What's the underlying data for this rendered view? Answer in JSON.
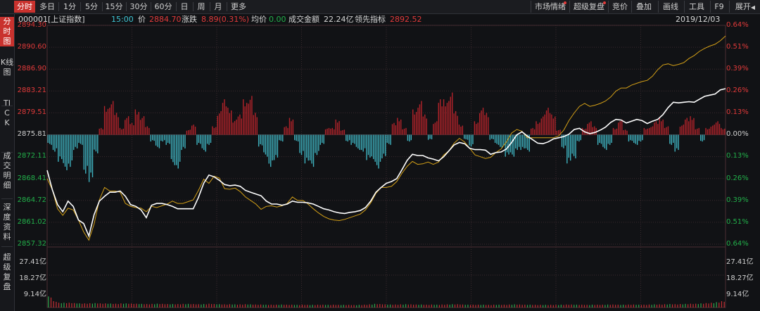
{
  "toolbar": {
    "tabs": [
      "分时",
      "多日",
      "1分",
      "5分",
      "15分",
      "30分",
      "60分",
      "日",
      "周",
      "月",
      "更多"
    ],
    "right_tabs": [
      "市场情绪",
      "超级复盘",
      "竞价",
      "叠加",
      "画线",
      "工具",
      "F9",
      "展开"
    ]
  },
  "sidebar": {
    "items": [
      "分时图",
      "K线图",
      "TICK",
      "成交明细",
      "深度资料",
      "超级复盘"
    ]
  },
  "info": {
    "code": "000001[上证指数]",
    "time": "15:00",
    "price_label": "价",
    "price": "2884.70",
    "change_label": "涨跌",
    "change": "8.89(0.31%)",
    "avg_label": "均价",
    "avg": "0.00",
    "amount_label": "成交金额",
    "amount": "22.24亿",
    "lead_label": "领先指标",
    "lead": "2892.52",
    "date": "2019/12/03"
  },
  "colors": {
    "up": "#e23a3a",
    "down": "#22b04a",
    "price_line": "#ffffff",
    "lead_line": "#d4a017",
    "bar_up": "#b3232a",
    "bar_down": "#3fb3c0",
    "grid": "#3a2a2e"
  },
  "chart_data": {
    "type": "line",
    "title": "",
    "xlabel": "",
    "ylabel": "",
    "ylim": [
      2857.32,
      2894.3
    ],
    "prev_close": 2875.81,
    "price_axis": [
      "2894.30",
      "2890.60",
      "2886.90",
      "2883.21",
      "2879.51",
      "2875.81",
      "2872.11",
      "2868.41",
      "2864.72",
      "2861.02",
      "2857.32"
    ],
    "pct_axis": [
      "0.64%",
      "0.51%",
      "0.39%",
      "0.26%",
      "0.13%",
      "0.00%",
      "0.13%",
      "0.26%",
      "0.39%",
      "0.51%",
      "0.64%"
    ],
    "volume_axis": [
      "27.41亿",
      "18.27亿",
      "9.14亿"
    ],
    "volume_ylim": [
      0,
      36.55
    ],
    "series": [
      {
        "key": "price",
        "values": [
          2869.8,
          2866.5,
          2864.0,
          2862.8,
          2864.6,
          2863.7,
          2861.4,
          2860.8,
          2858.7,
          2862.3,
          2864.6,
          2865.4,
          2866.1,
          2866.1,
          2866.3,
          2865.4,
          2864.0,
          2863.7,
          2863.1,
          2861.8,
          2863.9,
          2864.2,
          2864.2,
          2864.0,
          2863.7,
          2863.3,
          2863.3,
          2863.3,
          2863.3,
          2865.2,
          2867.6,
          2869.0,
          2868.7,
          2868.1,
          2867.4,
          2867.2,
          2867.3,
          2867.1,
          2866.4,
          2866.1,
          2865.8,
          2865.5,
          2864.6,
          2864.1,
          2864.1,
          2863.9,
          2864.1,
          2864.6,
          2864.4,
          2864.4,
          2864.3,
          2864.1,
          2863.7,
          2863.3,
          2863.1,
          2862.8,
          2862.6,
          2862.5,
          2862.7,
          2862.8,
          2863.0,
          2863.5,
          2864.6,
          2866.1,
          2866.9,
          2867.6,
          2867.9,
          2868.4,
          2869.9,
          2871.5,
          2872.5,
          2872.3,
          2872.3,
          2871.9,
          2871.7,
          2871.4,
          2872.1,
          2873.1,
          2874.1,
          2874.5,
          2874.3,
          2873.5,
          2873.3,
          2873.3,
          2873.2,
          2872.5,
          2872.8,
          2872.9,
          2873.4,
          2874.5,
          2875.8,
          2876.3,
          2875.6,
          2875.0,
          2874.4,
          2874.3,
          2874.6,
          2875.1,
          2875.3,
          2875.5,
          2875.9,
          2876.7,
          2876.9,
          2876.3,
          2876.0,
          2876.2,
          2876.6,
          2877.1,
          2877.9,
          2878.4,
          2878.3,
          2877.8,
          2878.1,
          2878.4,
          2878.2,
          2877.7,
          2878.1,
          2878.4,
          2879.2,
          2880.4,
          2881.3,
          2881.2,
          2881.3,
          2881.4,
          2881.3,
          2881.8,
          2882.3,
          2882.5,
          2882.7,
          2883.4,
          2883.6
        ]
      },
      {
        "key": "lead",
        "values": [
          2868.4,
          2866.5,
          2863.3,
          2862.2,
          2863.4,
          2863.1,
          2861.4,
          2859.4,
          2858.0,
          2860.7,
          2864.8,
          2866.9,
          2866.3,
          2866.3,
          2866.1,
          2864.2,
          2863.7,
          2863.5,
          2863.4,
          2862.8,
          2863.7,
          2863.5,
          2863.8,
          2864.1,
          2864.6,
          2864.2,
          2864.2,
          2864.5,
          2864.8,
          2866.4,
          2868.3,
          2867.6,
          2868.8,
          2868.5,
          2866.7,
          2866.6,
          2866.8,
          2866.2,
          2865.3,
          2864.7,
          2864.1,
          2863.2,
          2863.7,
          2863.8,
          2863.6,
          2863.8,
          2864.2,
          2865.3,
          2864.7,
          2864.7,
          2864.1,
          2863.3,
          2862.6,
          2862.0,
          2861.6,
          2861.4,
          2861.3,
          2861.5,
          2861.8,
          2862.1,
          2862.4,
          2863.1,
          2864.3,
          2865.9,
          2866.9,
          2866.9,
          2867.1,
          2867.9,
          2869.3,
          2870.5,
          2871.3,
          2870.8,
          2870.9,
          2871.2,
          2870.8,
          2871.2,
          2872.4,
          2873.1,
          2874.4,
          2875.2,
          2874.6,
          2873.5,
          2872.4,
          2872.1,
          2871.8,
          2872.0,
          2872.8,
          2873.4,
          2874.6,
          2876.1,
          2876.7,
          2876.4,
          2875.3,
          2875.3,
          2875.3,
          2875.3,
          2875.3,
          2875.3,
          2875.6,
          2876.6,
          2878.2,
          2879.5,
          2880.6,
          2881.1,
          2880.6,
          2880.8,
          2881.1,
          2881.5,
          2882.2,
          2883.2,
          2883.7,
          2883.7,
          2884.2,
          2884.5,
          2884.8,
          2885.0,
          2885.7,
          2886.8,
          2887.6,
          2887.8,
          2887.5,
          2887.7,
          2888.0,
          2888.7,
          2889.2,
          2889.9,
          2890.4,
          2890.8,
          2891.1,
          2891.7,
          2892.5
        ]
      }
    ],
    "lead_bars": [
      -0.6,
      -1.0,
      -1.6,
      -2.1,
      -1.9,
      -0.9,
      -0.6,
      -2.3,
      -2.8,
      -1.1,
      0.4,
      1.7,
      2.0,
      1.3,
      0.4,
      1.1,
      0.7,
      1.5,
      1.1,
      0.5,
      -0.4,
      -0.8,
      -0.4,
      -0.6,
      -1.8,
      -2.0,
      -0.9,
      0.3,
      0.6,
      -0.6,
      -1.0,
      -0.6,
      0.5,
      1.4,
      2.1,
      1.6,
      0.9,
      1.2,
      2.1,
      2.3,
      1.3,
      -0.7,
      -1.3,
      -1.9,
      -1.5,
      -0.4,
      0.5,
      1.0,
      -0.4,
      -1.2,
      -1.7,
      -1.9,
      -1.2,
      -0.6,
      0.4,
      0.4,
      0.9,
      0.3,
      -0.4,
      -0.6,
      -0.9,
      -1.0,
      -1.5,
      -1.6,
      -2.0,
      -1.4,
      -0.6,
      0.7,
      1.0,
      0.4,
      -0.4,
      1.5,
      2.0,
      1.2,
      -0.3,
      0.8,
      2.1,
      2.1,
      2.5,
      1.4,
      0.6,
      -0.3,
      -0.7,
      0.8,
      1.6,
      1.3,
      -0.3,
      -0.6,
      -0.8,
      -1.3,
      -1.3,
      -0.9,
      -0.9,
      -1.0,
      0.4,
      0.8,
      1.2,
      1.6,
      1.2,
      0.3,
      -0.8,
      -1.7,
      -1.4,
      -0.4,
      0.4,
      0.8,
      0.5,
      -0.6,
      -0.9,
      -0.6,
      0.4,
      0.9,
      0.3,
      -0.4,
      -0.6,
      -0.4,
      0.4,
      0.5,
      0.8,
      1.0,
      0.5,
      -0.6,
      -1.0,
      0.6,
      1.0,
      1.1,
      0.4,
      -0.4,
      0.4,
      0.6,
      0.8,
      0.4
    ],
    "volumes": [
      7,
      4,
      3,
      3,
      3,
      2.8,
      2.6,
      2.6,
      2.7,
      2.8,
      2.6,
      2.6,
      2.5,
      2.4,
      2.6,
      2.6,
      2.5,
      2.4,
      2.3,
      2.2,
      2.3,
      2.4,
      2.3,
      2.2,
      2.2,
      2.2,
      2.3,
      2.3,
      2.2,
      2.1,
      2.2,
      2.4,
      2.2,
      2.1,
      2.0,
      2.1,
      2.0,
      2.0,
      2.1,
      2.0,
      1.9,
      1.9,
      1.8,
      1.8,
      1.8,
      1.9,
      1.8,
      1.8,
      1.7,
      1.8,
      1.7,
      1.7,
      1.8,
      1.8,
      1.7,
      1.8,
      1.7,
      1.7,
      1.7,
      1.6,
      1.7,
      1.8,
      2.0,
      2.3,
      2.2,
      2.0,
      1.9,
      1.9,
      2.0,
      2.1,
      2.0,
      1.9,
      1.9,
      1.8,
      1.9,
      1.8,
      1.9,
      2.0,
      2.1,
      2.1,
      1.9,
      1.8,
      1.8,
      1.8,
      1.8,
      1.7,
      1.8,
      1.8,
      1.8,
      1.9,
      2.0,
      1.9,
      1.8,
      1.8,
      1.7,
      1.7,
      1.7,
      1.7,
      1.7,
      1.8,
      1.9,
      1.9,
      1.8,
      1.8,
      1.7,
      1.8,
      1.8,
      1.8,
      1.9,
      1.9,
      1.8,
      1.8,
      1.9,
      1.9,
      1.8,
      1.8,
      1.9,
      2.0,
      2.0,
      2.1,
      2.2,
      2.1,
      2.2,
      2.3,
      2.4,
      2.4,
      2.6,
      2.8,
      3.0,
      3.4,
      4.0
    ]
  }
}
